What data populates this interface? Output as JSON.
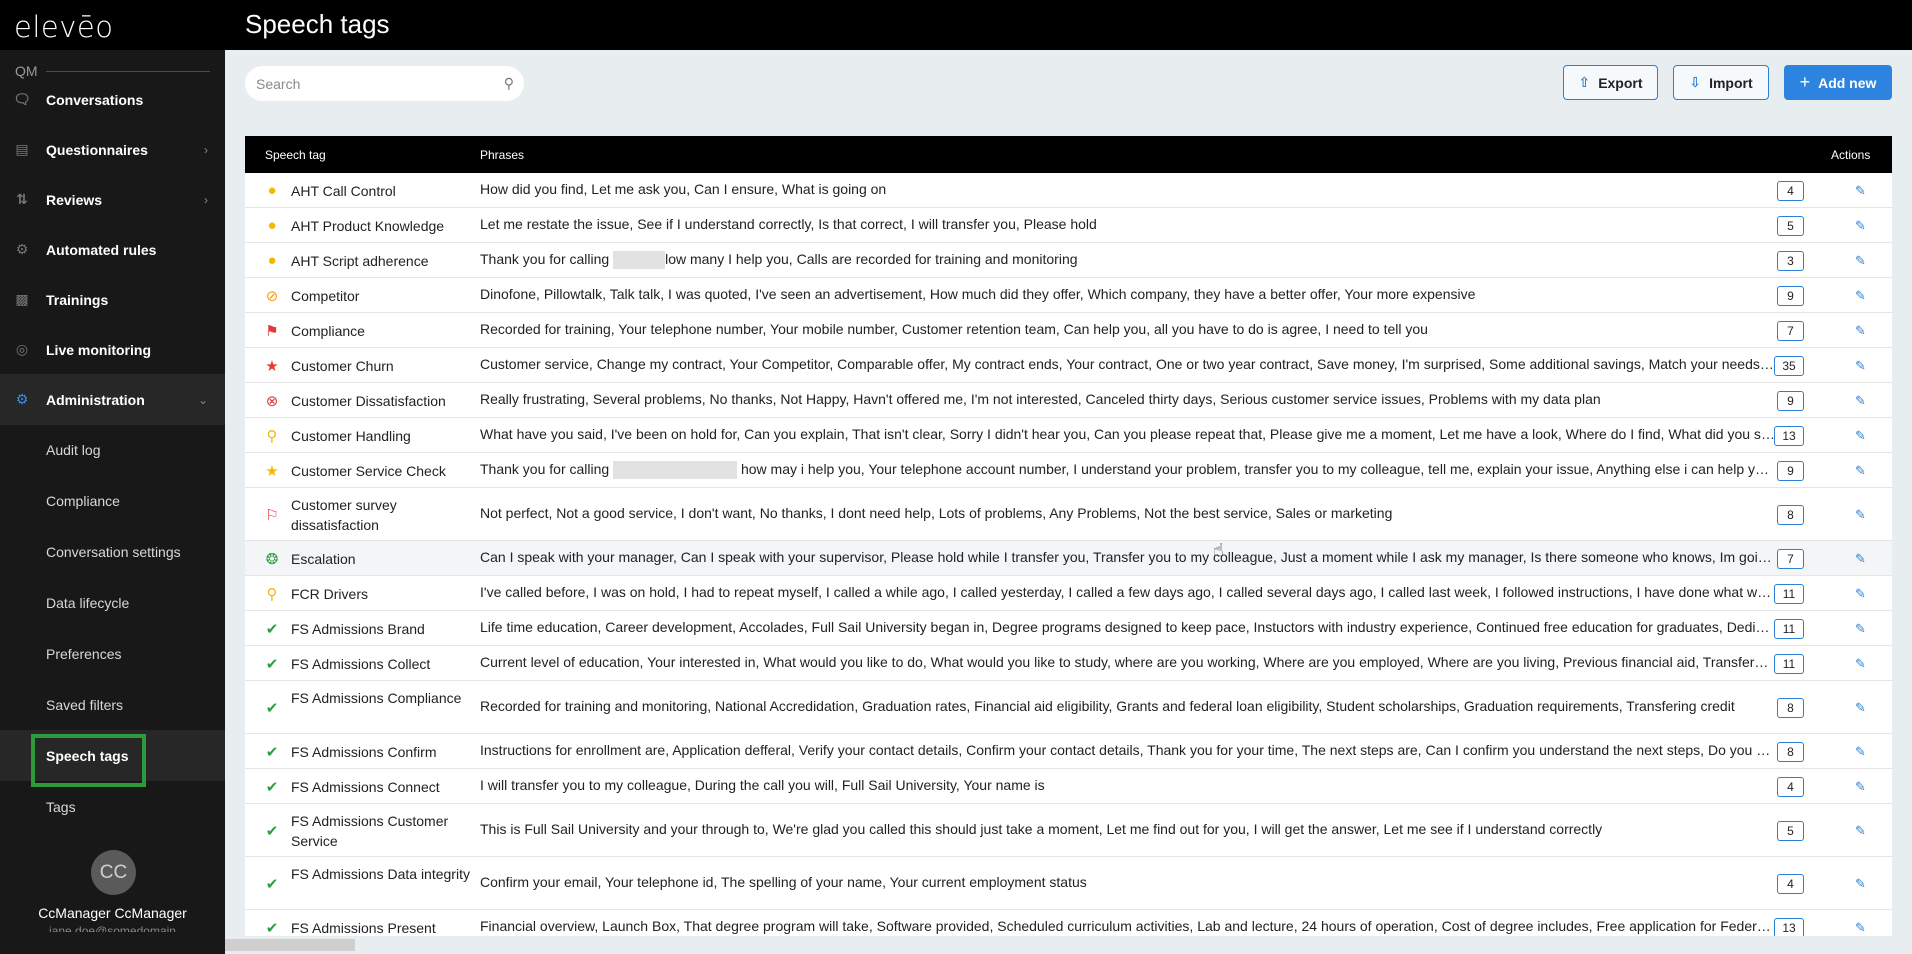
{
  "app": {
    "logo_text": "elevēo",
    "page_title": "Speech tags"
  },
  "sidebar": {
    "section": "QM",
    "items": [
      {
        "label": "Conversations",
        "icon": "chat-icon",
        "chevron": false
      },
      {
        "label": "Questionnaires",
        "icon": "document-icon",
        "chevron": true
      },
      {
        "label": "Reviews",
        "icon": "review-icon",
        "chevron": true
      },
      {
        "label": "Automated rules",
        "icon": "rules-icon",
        "chevron": false
      },
      {
        "label": "Trainings",
        "icon": "training-icon",
        "chevron": false
      },
      {
        "label": "Live monitoring",
        "icon": "monitoring-icon",
        "chevron": false
      },
      {
        "label": "Administration",
        "icon": "gear-icon",
        "chevron": true
      }
    ],
    "admin_subitems": [
      "Audit log",
      "Compliance",
      "Conversation settings",
      "Data lifecycle",
      "Preferences",
      "Saved filters",
      "Speech tags",
      "Tags"
    ],
    "user": {
      "initials": "CC",
      "name": "CcManager CcManager",
      "email": "jane.doe@somedomain"
    }
  },
  "toolbar": {
    "search_placeholder": "Search",
    "export_label": "Export",
    "import_label": "Import",
    "add_label": "Add new"
  },
  "table": {
    "headers": {
      "tag": "Speech tag",
      "phrases": "Phrases",
      "actions": "Actions"
    },
    "rows": [
      {
        "name": "AHT Call Control",
        "phrases": "How did you find, Let me ask you, Can I ensure, What is going on",
        "count": "4",
        "icon": "bulb-icon",
        "color": "#f5b800"
      },
      {
        "name": "AHT Product Knowledge",
        "phrases": "Let me restate the issue, See if I understand correctly, Is that correct, I will transfer you, Please hold",
        "count": "5",
        "icon": "bulb-icon",
        "color": "#f5b800"
      },
      {
        "name": "AHT Script adherence",
        "phrases_pre": "Thank you for calling ",
        "phrases_post": "low many I help you, Calls are recorded for training and monitoring",
        "redact_width": 52,
        "count": "3",
        "icon": "bulb-icon",
        "color": "#f5b800"
      },
      {
        "name": "Competitor",
        "phrases": "Dinofone, Pillowtalk, Talk talk, I was quoted, I've seen an advertisement, How much did they offer, Which company, they have a better offer, Your more expensive",
        "count": "9",
        "icon": "ban-icon",
        "color": "#f39c12"
      },
      {
        "name": "Compliance",
        "phrases": "Recorded for training, Your telephone number, Your mobile number, Customer retention team, Can help you, all you have to do is agree, I need to tell you",
        "count": "7",
        "icon": "flag-icon",
        "color": "#e53935"
      },
      {
        "name": "Customer Churn",
        "phrases": "Customer service, Change my contract, Your Competitor, Comparable offer, My contract ends, Your contract, One or two year contract, Save money, I'm surprised, Some additional savings, Match your needs, Moving to another provider",
        "count": "35",
        "icon": "star-icon",
        "color": "#e53935"
      },
      {
        "name": "Customer Dissatisfaction",
        "phrases": "Really frustrating, Several problems, No thanks, Not Happy, Havn't offered me, I'm not interested, Canceled thirty days, Serious customer service issues, Problems with my data plan",
        "count": "9",
        "icon": "circle-x-icon",
        "color": "#e53935"
      },
      {
        "name": "Customer Handling",
        "phrases": "What have you said, I've been on hold for, Can you explain, That isn't clear, Sorry I didn't hear you, Can you please repeat that, Please give me a moment, Let me have a look, Where do I find, What did you say, I can't find it",
        "count": "13",
        "icon": "pin-icon",
        "color": "#f5b800"
      },
      {
        "name": "Customer Service Check",
        "phrases_pre": "Thank you for calling ",
        "phrases_post": " how may i help you, Your telephone account number, I understand your problem, transfer you to my colleague, tell me, explain your issue, Anything else i can help you with",
        "redact_width": 124,
        "count": "9",
        "icon": "star-icon",
        "color": "#f5b800"
      },
      {
        "name": "Customer survey dissatisfaction",
        "phrases": "Not perfect, Not a good service, I don't want, No thanks, I dont need help, Lots of problems, Any Problems, Not the best service, Sales or marketing",
        "count": "8",
        "icon": "small-flag-icon",
        "color": "#e53935"
      },
      {
        "name": "Escalation",
        "phrases": "Can I speak with your manager, Can I speak with your supervisor, Please hold while I transfer you, Transfer you to my colleague, Just a moment while I ask my manager, Is there someone who knows, Im going to escalate this",
        "count": "7",
        "icon": "lifebuoy-icon",
        "color": "#2e9e44"
      },
      {
        "name": "FCR Drivers",
        "phrases": "I've called before, I was on hold, I had to repeat myself, I called a while ago, I called yesterday, I called a few days ago, I called several days ago, I called last week, I followed instructions, I have done what was asked",
        "count": "11",
        "icon": "pin-icon",
        "color": "#f5b800"
      },
      {
        "name": "FS Admissions Brand",
        "phrases": "Life time education, Career development, Accolades, Full Sail University began in, Degree programs designed to keep pace, Instuctors with industry experience, Continued free education for graduates, Dedicated career services",
        "count": "11",
        "icon": "check-icon",
        "color": "#2e9e44"
      },
      {
        "name": "FS Admissions Collect",
        "phrases": "Current level of education, Your interested in, What would you like to do, What would you like to study, where are you working, Where are you employed, Where are you living, Previous financial aid, Transferable credits",
        "count": "11",
        "icon": "check-icon",
        "color": "#2e9e44"
      },
      {
        "name": "FS Admissions Compliance",
        "phrases": "Recorded for training and monitoring, National Accredidation, Graduation rates, Financial aid eligibility, Grants and federal loan eligibility, Student scholarships, Graduation requirements, Transfering credit",
        "count": "8",
        "icon": "check-icon",
        "color": "#2e9e44"
      },
      {
        "name": "FS Admissions Confirm",
        "phrases": "Instructions for enrollment are, Application defferal, Verify your contact details, Confirm your contact details, Thank you for your time, The next steps are, Can I confirm you understand the next steps, Do you have any questions",
        "count": "8",
        "icon": "check-icon",
        "color": "#2e9e44"
      },
      {
        "name": "FS Admissions Connect",
        "phrases": "I will transfer you to my colleague, During the call you will, Full Sail University, Your name is",
        "count": "4",
        "icon": "check-icon",
        "color": "#2e9e44"
      },
      {
        "name": "FS Admissions Customer Service",
        "phrases": "This is Full Sail University and your through to, We're glad you called this should just take a moment, Let me find out for you, I will get the answer, Let me see if I understand correctly",
        "count": "5",
        "icon": "check-icon",
        "color": "#2e9e44"
      },
      {
        "name": "FS Admissions Data integrity",
        "phrases": "Confirm your email, Your telephone id, The spelling of your name, Your current employment status",
        "count": "4",
        "icon": "check-icon",
        "color": "#2e9e44"
      },
      {
        "name": "FS Admissions Present",
        "phrases": "Financial overview, Launch Box, That degree program will take, Software provided, Scheduled curriculum activities, Lab and lecture, 24 hours of operation, Cost of degree includes, Free application for Federal student aid",
        "count": "13",
        "icon": "check-icon",
        "color": "#2e9e44"
      }
    ]
  }
}
